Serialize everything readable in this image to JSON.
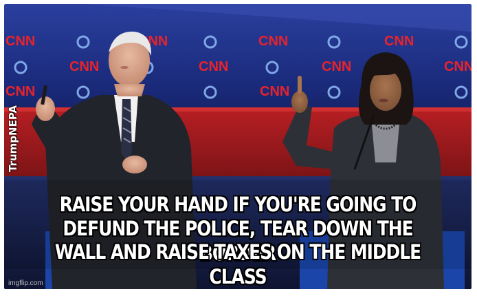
{
  "meme": {
    "caption_lines": [
      "RAISE YOUR HAND IF YOU'RE GOING TO",
      "DEFUND THE POLICE, TEAR DOWN THE BORDER",
      "WALL AND RAISE TAXES ON THE MIDDLE CLASS"
    ],
    "watermark": "TrumpNEPA",
    "credit": "imgflip.com",
    "logo_text": "CNN",
    "colors": {
      "backdrop_blue": "#1d2f86",
      "stage_red": "#c8282a",
      "podium_blue": "#1b45a8",
      "suit_dark": "#23252b"
    }
  }
}
